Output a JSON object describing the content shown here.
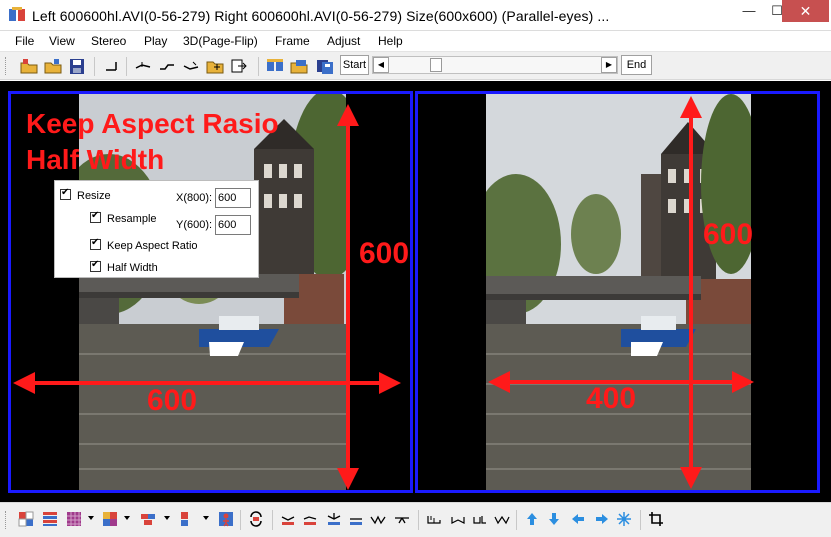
{
  "window": {
    "title": "Left 600600hl.AVI(0-56-279) Right 600600hl.AVI(0-56-279) Size(600x600)  (Parallel-eyes) ...",
    "minimize": "—",
    "maximize": "☐",
    "close": "✕"
  },
  "menu": [
    "File",
    "View",
    "Stereo",
    "Play",
    "3D(Page-Flip)",
    "Frame",
    "Adjust",
    "Help"
  ],
  "toolbar": {
    "start_label": "Start",
    "end_label": "End",
    "scroll_left": "◀",
    "scroll_right": "▶"
  },
  "annotations": {
    "headline_line1": "Keep Aspect Rasio",
    "headline_line2": "Half Width",
    "left_height": "600",
    "left_width": "600",
    "right_height": "600",
    "right_width": "400",
    "color": "#ff1a1a"
  },
  "resize_panel": {
    "resize_label": "Resize",
    "resample_label": "Resample",
    "keep_aspect_label": "Keep Aspect Ratio",
    "half_width_label": "Half Width",
    "x_label": "X(800):",
    "x_value": "600",
    "y_label": "Y(600):",
    "y_value": "600"
  },
  "colors": {
    "pane_border": "#1a1aff",
    "close_button": "#c75050",
    "annotation": "#ff1a1a"
  }
}
